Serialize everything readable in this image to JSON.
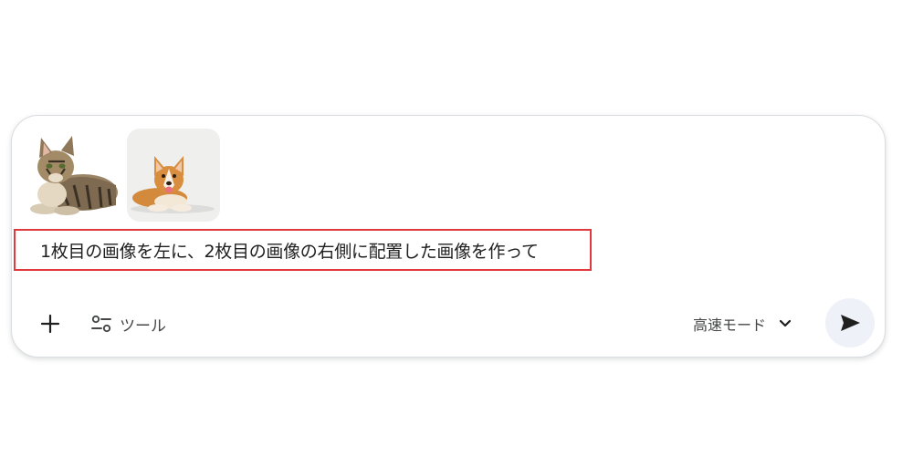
{
  "attachments": [
    {
      "name": "cat-image",
      "alt": "tabby cat lying down"
    },
    {
      "name": "dog-image",
      "alt": "corgi lying down"
    }
  ],
  "prompt": {
    "value": "1枚目の画像を左に、2枚目の画像の右側に配置した画像を作って"
  },
  "toolbar": {
    "add_icon": "plus-icon",
    "tools_label": "ツール",
    "tools_icon": "tune-icon",
    "mode_label": "高速モード",
    "mode_icon": "chevron-down-icon",
    "send_icon": "send-icon"
  },
  "colors": {
    "highlight_border": "#e0393e",
    "send_bg": "#eef1f8",
    "text": "#1f1f1f",
    "secondary_text": "#444746"
  }
}
